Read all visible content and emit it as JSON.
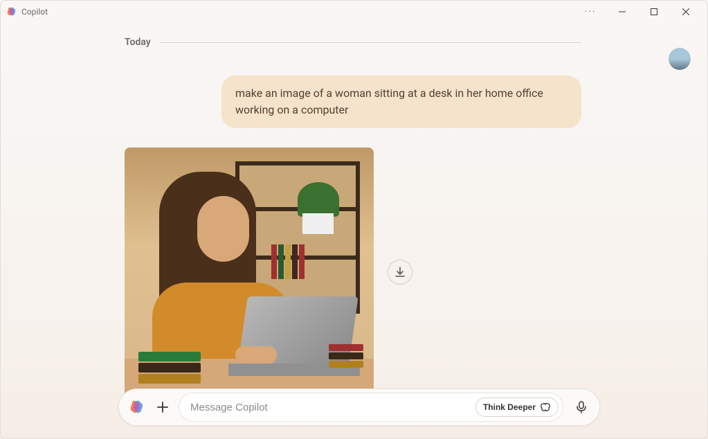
{
  "titlebar": {
    "title": "Copilot",
    "more": "···"
  },
  "avatar": {
    "alt": "User avatar"
  },
  "conversation": {
    "date_label": "Today",
    "user_message": "make an image of a woman sitting at a desk in her home office working on a computer",
    "generated_image_alt": "Generated image of a woman sitting at a desk in her home office working on a laptop"
  },
  "input_bar": {
    "placeholder": "Message Copilot",
    "think_deeper_label": "Think Deeper"
  },
  "icons": {
    "copilot": "copilot-logo",
    "plus": "plus",
    "download": "download",
    "mic": "microphone",
    "brain": "brain"
  }
}
